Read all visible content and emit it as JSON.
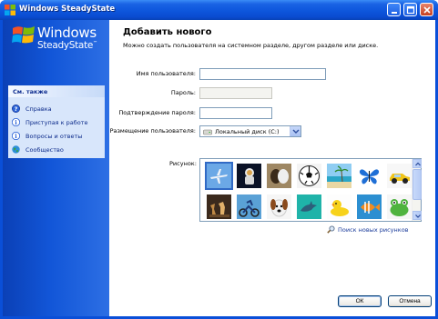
{
  "window": {
    "title": "Windows SteadyState"
  },
  "logo": {
    "line1": "Windows",
    "line2": "SteadyState",
    "tm": "™"
  },
  "see_also": {
    "header": "См. также",
    "items": [
      {
        "label": "Справка",
        "icon": "help-icon"
      },
      {
        "label": "Приступая к работе",
        "icon": "info-icon"
      },
      {
        "label": "Вопросы и ответы",
        "icon": "info-icon"
      },
      {
        "label": "Сообщество",
        "icon": "globe-icon"
      }
    ]
  },
  "main": {
    "heading": "Добавить нового",
    "subheading": "Можно создать пользователя на системном разделе, другом разделе или диске."
  },
  "form": {
    "username_label": "Имя пользователя:",
    "username_value": "",
    "password_label": "Пароль:",
    "password_value": "",
    "confirm_label": "Подтверждение пароля:",
    "confirm_value": "",
    "location_label": "Размещение пользователя:",
    "location_value": "Локальный диск (C:)",
    "picture_label": "Рисунок:"
  },
  "pictures": [
    {
      "name": "airplane-picture"
    },
    {
      "name": "astronaut-picture"
    },
    {
      "name": "horses-picture"
    },
    {
      "name": "soccer-ball-picture"
    },
    {
      "name": "beach-picture"
    },
    {
      "name": "butterfly-picture"
    },
    {
      "name": "toy-car-picture"
    },
    {
      "name": "cat-picture"
    },
    {
      "name": "chess-picture"
    },
    {
      "name": "dirt-bike-picture"
    },
    {
      "name": "dog-picture"
    },
    {
      "name": "dolphin-picture"
    },
    {
      "name": "rubber-duck-picture"
    },
    {
      "name": "fish-picture"
    },
    {
      "name": "frog-picture"
    }
  ],
  "search_pictures": {
    "label": "Поиск новых рисунков"
  },
  "buttons": {
    "ok": "ОК",
    "cancel": "Отмена"
  },
  "colors": {
    "title_bar": "#0a4bd0",
    "left_pane": "#1256d8",
    "link": "#0b2a8a"
  }
}
